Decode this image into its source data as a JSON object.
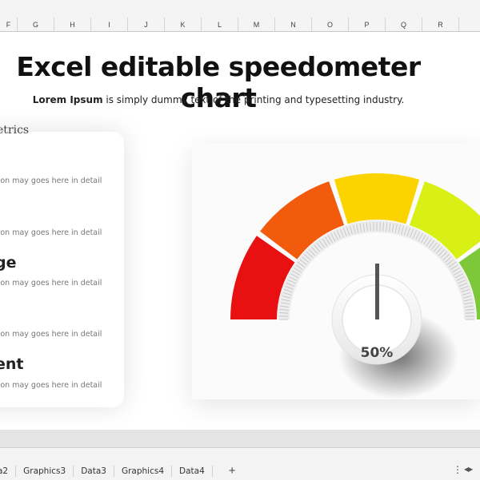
{
  "sheet": {
    "columns": [
      "F",
      "G",
      "H",
      "I",
      "J",
      "K",
      "L",
      "M",
      "N",
      "O",
      "P",
      "Q",
      "R"
    ]
  },
  "header": {
    "title": "Excel editable speedometer chart",
    "subtitle_bold": "Lorem Ipsum",
    "subtitle_rest": " is simply dummy text of the printing and typesetting industry."
  },
  "panel": {
    "title": "etrics",
    "items": [
      {
        "name": "",
        "desc": "tion may goes here in detail"
      },
      {
        "name": "",
        "desc": "tion may goes here in detail"
      },
      {
        "name": "ge",
        "desc": "tion may goes here in detail"
      },
      {
        "name": "",
        "desc": "tion may goes here in detail"
      },
      {
        "name": "ent",
        "desc": "tion may goes here in detail"
      }
    ]
  },
  "gauge": {
    "value_label": "50%",
    "value": 0.5,
    "segment_colors": [
      "#e81010",
      "#f25a0c",
      "#fbd400",
      "#d8f016",
      "#7cc83a"
    ]
  },
  "tabs": {
    "items": [
      "a2",
      "Graphics3",
      "Data3",
      "Graphics4",
      "Data4"
    ],
    "add_icon": "plus-icon",
    "more_icon": "vertical-ellipsis-icon"
  }
}
